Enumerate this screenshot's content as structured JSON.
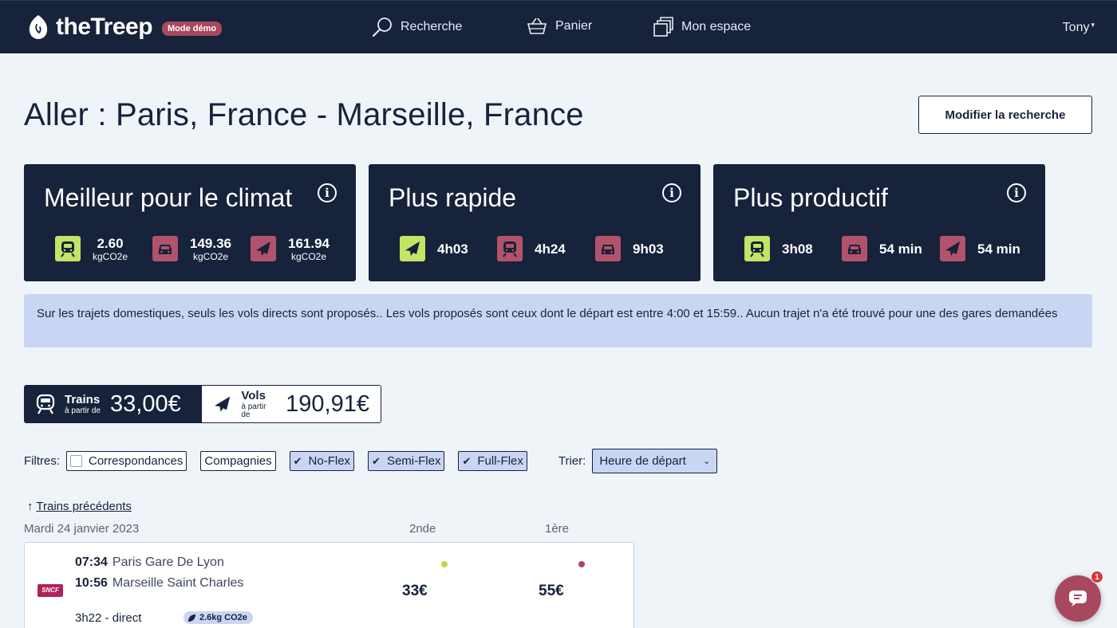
{
  "header": {
    "brand": "theTreep",
    "demo_badge": "Mode démo",
    "nav": [
      {
        "label": "Recherche",
        "icon": "search-icon"
      },
      {
        "label": "Panier",
        "icon": "basket-icon"
      },
      {
        "label": "Mon espace",
        "icon": "documents-icon"
      }
    ],
    "user": "Tony"
  },
  "page": {
    "title": "Aller : Paris, France - Marseille, France",
    "modify_button": "Modifier la recherche"
  },
  "cards": [
    {
      "title": "Meilleur pour le climat",
      "stats": [
        {
          "mode": "train",
          "color": "#c5e365",
          "value": "2.60",
          "unit": "kgCO2e"
        },
        {
          "mode": "car",
          "color": "#b1536b",
          "value": "149.36",
          "unit": "kgCO2e"
        },
        {
          "mode": "plane",
          "color": "#b1536b",
          "value": "161.94",
          "unit": "kgCO2e"
        }
      ]
    },
    {
      "title": "Plus rapide",
      "stats": [
        {
          "mode": "plane",
          "color": "#c5e365",
          "value": "4h03"
        },
        {
          "mode": "train",
          "color": "#b1536b",
          "value": "4h24"
        },
        {
          "mode": "car",
          "color": "#b1536b",
          "value": "9h03"
        }
      ]
    },
    {
      "title": "Plus productif",
      "stats": [
        {
          "mode": "train",
          "color": "#c5e365",
          "value": "3h08"
        },
        {
          "mode": "car",
          "color": "#b1536b",
          "value": "54 min"
        },
        {
          "mode": "plane",
          "color": "#b1536b",
          "value": "54 min"
        }
      ]
    }
  ],
  "notice": "Sur les trajets domestiques, seuls les vols directs sont proposés.. Les vols proposés sont ceux dont le départ est entre 4:00 et 15:59.. Aucun trajet n'a été trouvé pour une des gares demandées",
  "mode_tabs": [
    {
      "name": "Trains",
      "sub": "à partir de",
      "price": "33,00€",
      "active": true
    },
    {
      "name": "Vols",
      "sub": "à partir de",
      "price": "190,91€",
      "active": false
    }
  ],
  "filters": {
    "label": "Filtres:",
    "chips": [
      {
        "label": "Correspondances",
        "checked": false
      },
      {
        "label": "Compagnies",
        "checked": null
      },
      {
        "label": "No-Flex",
        "checked": true
      },
      {
        "label": "Semi-Flex",
        "checked": true
      },
      {
        "label": "Full-Flex",
        "checked": true
      }
    ],
    "sort_label": "Trier:",
    "sort_value": "Heure de départ"
  },
  "results": {
    "prev_link": "Trains précédents",
    "date": "Mardi 24 janvier 2023",
    "col_second": "2nde",
    "col_first": "1ère",
    "items": [
      {
        "carrier": "SNCF",
        "dep_time": "07:34",
        "dep_station": "Paris Gare De Lyon",
        "arr_time": "10:56",
        "arr_station": "Marseille Saint Charles",
        "price_second": "33€",
        "price_first": "55€",
        "duration": "3h22 - direct",
        "co2": "2.6kg CO2e"
      }
    ]
  },
  "chat": {
    "badge": "1"
  }
}
